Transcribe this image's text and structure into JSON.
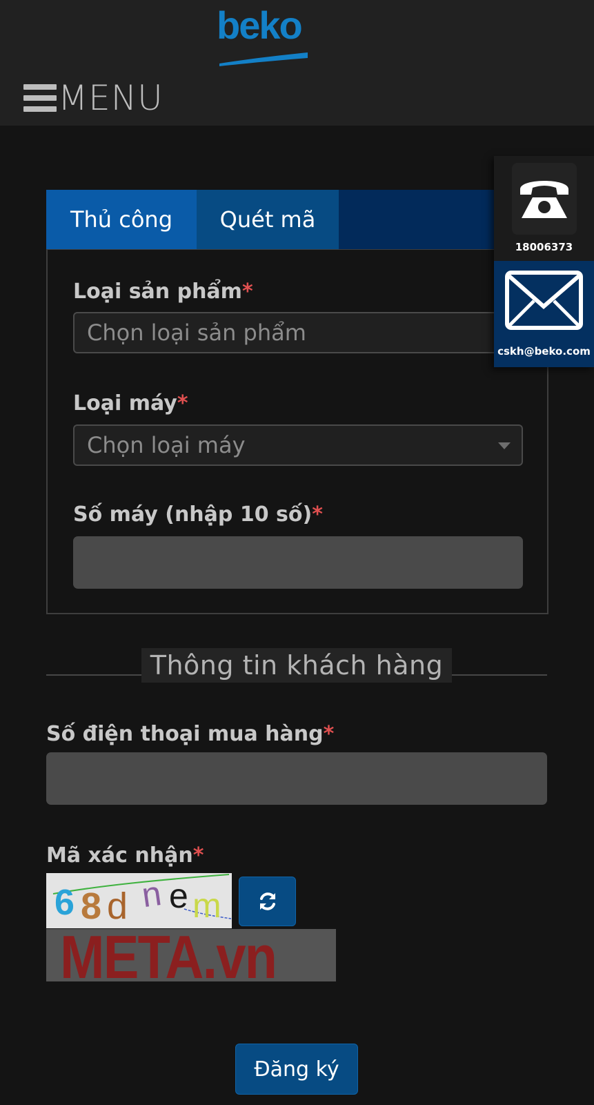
{
  "brand": {
    "logo_text": "beko"
  },
  "header": {
    "menu_label": "MENU"
  },
  "tabs": [
    {
      "label": "Thủ công",
      "active": true
    },
    {
      "label": "Quét mã",
      "active": false
    }
  ],
  "form": {
    "product_type": {
      "label": "Loại sản phẩm",
      "required_mark": "*",
      "placeholder": "Chọn loại sản phẩm"
    },
    "machine_type": {
      "label": "Loại máy",
      "required_mark": "*",
      "placeholder": "Chọn loại máy"
    },
    "serial": {
      "label": "Số máy (nhập 10 số)",
      "required_mark": "*",
      "value": ""
    }
  },
  "customer_section": {
    "title": "Thông tin khách hàng",
    "phone": {
      "label": "Số điện thoại mua hàng",
      "required_mark": "*",
      "value": ""
    },
    "captcha": {
      "label": "Mã xác nhận",
      "required_mark": "*",
      "code": "68dnem",
      "refresh_icon": "refresh-icon"
    }
  },
  "watermark": {
    "text": "META.vn"
  },
  "submit_label": "Đăng ký",
  "contact": {
    "phone_number": "18006373",
    "phone_icon": "telephone-icon",
    "email": "cskh@beko.com",
    "email_icon": "envelope-icon"
  },
  "colors": {
    "brand_blue": "#1380c7",
    "tab_active": "#0a5ba8",
    "button_blue": "#074b83",
    "required": "#e05050",
    "background": "#141414"
  }
}
